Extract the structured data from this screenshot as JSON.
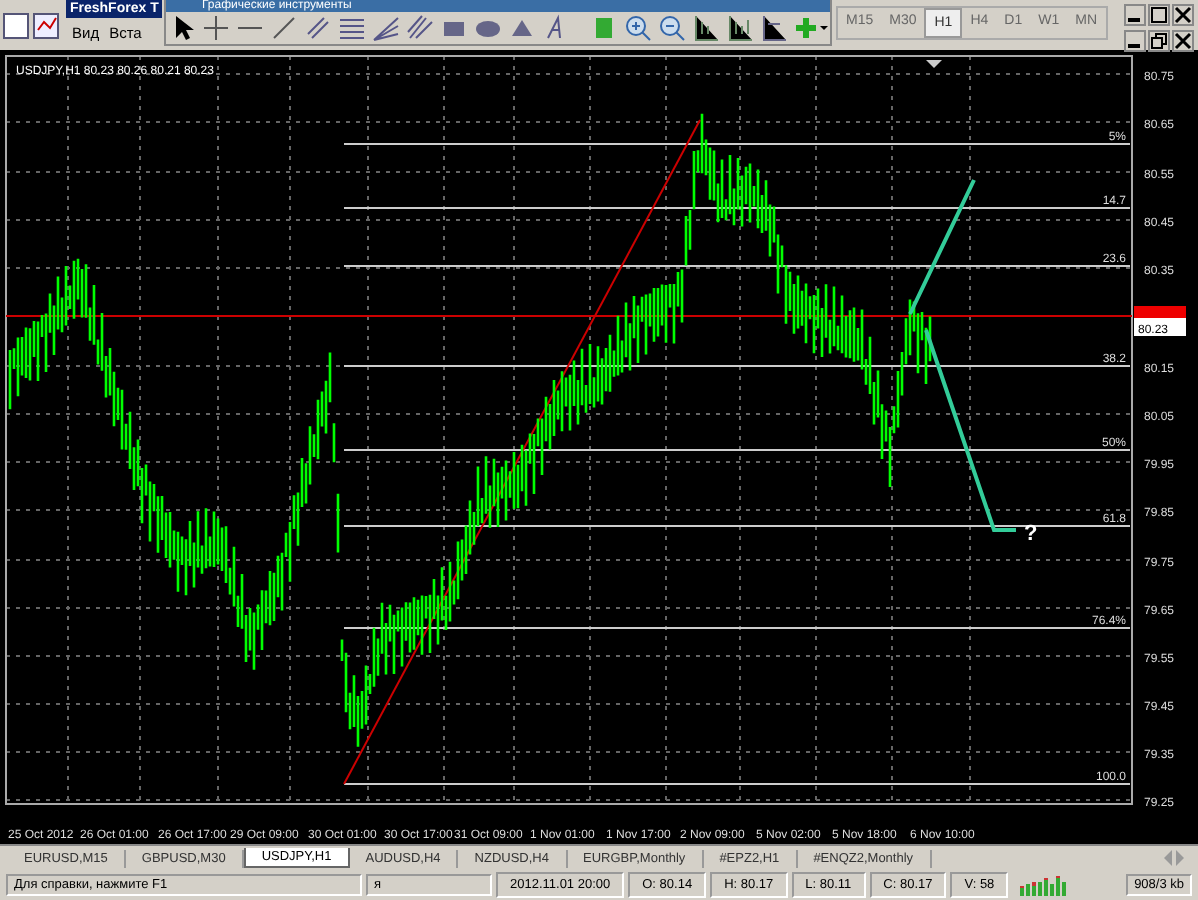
{
  "window": {
    "title": "FreshForex T"
  },
  "menu": [
    "Вид",
    "Вста"
  ],
  "floating_toolbar": {
    "title": "Графические инструменты"
  },
  "timeframes": [
    {
      "label": "M15",
      "selected": false
    },
    {
      "label": "M30",
      "selected": false
    },
    {
      "label": "H1",
      "selected": true
    },
    {
      "label": "H4",
      "selected": false
    },
    {
      "label": "D1",
      "selected": false
    },
    {
      "label": "W1",
      "selected": false
    },
    {
      "label": "MN",
      "selected": false
    }
  ],
  "chart": {
    "info": "USDJPY,H1  80.23 80.26 80.21 80.23",
    "price_ticks": [
      "80.75",
      "80.65",
      "80.55",
      "80.45",
      "80.35",
      "80.15",
      "80.05",
      "79.95",
      "79.85",
      "79.75",
      "79.65",
      "79.55",
      "79.45",
      "79.35",
      "79.25"
    ],
    "current_price": "80.23",
    "fib_levels": [
      "5%",
      "14.7",
      "23.6",
      "38.2",
      "50%",
      "61.8",
      "76.4%",
      "100.0"
    ],
    "question_mark": "?",
    "time_labels": [
      "25 Oct 2012",
      "26 Oct 01:00",
      "26 Oct 17:00",
      "29 Oct 09:00",
      "30 Oct 01:00",
      "30 Oct 17:00",
      "31 Oct 09:00",
      "1 Nov 01:00",
      "1 Nov 17:00",
      "2 Nov 09:00",
      "5 Nov 02:00",
      "5 Nov 18:00",
      "6 Nov 10:00"
    ]
  },
  "tabs": [
    {
      "label": "EURUSD,M15",
      "selected": false
    },
    {
      "label": "GBPUSD,M30",
      "selected": false
    },
    {
      "label": "USDJPY,H1",
      "selected": true
    },
    {
      "label": "AUDUSD,H4",
      "selected": false
    },
    {
      "label": "NZDUSD,H4",
      "selected": false
    },
    {
      "label": "EURGBP,Monthly",
      "selected": false
    },
    {
      "label": "#EPZ2,H1",
      "selected": false
    },
    {
      "label": "#ENQZ2,Monthly",
      "selected": false
    }
  ],
  "status_bar": {
    "help": "Для справки, нажмите F1",
    "profile": "я",
    "fields": [
      "2012.11.01 20:00",
      "O: 80.14",
      "H: 80.17",
      "L: 80.11",
      "C: 80.17",
      "V: 58"
    ],
    "traffic": "908/3 kb"
  }
}
